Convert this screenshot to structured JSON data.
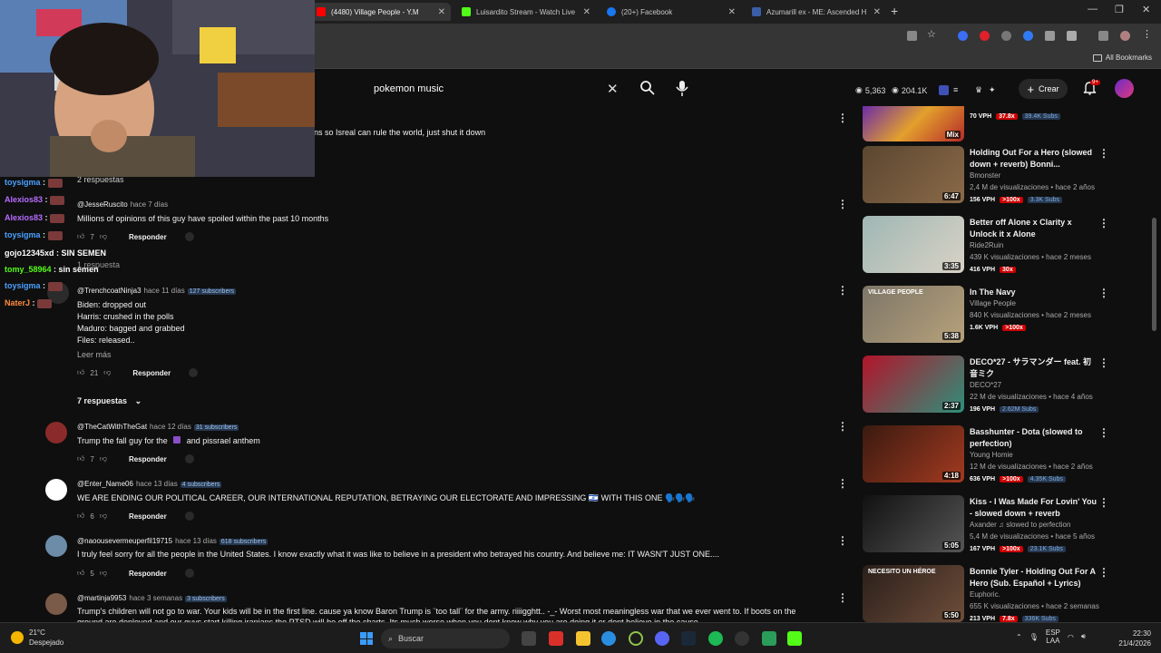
{
  "browser": {
    "tabs": [
      {
        "title": "(4480) Village People - Y.M",
        "color": "#ff0000",
        "active": true
      },
      {
        "title": "Luisardito Stream - Watch Live",
        "color": "#53fc18",
        "active": false
      },
      {
        "title": "(20+) Facebook",
        "color": "#1877f2",
        "active": false
      },
      {
        "title": "Azumarill ex - ME: Ascended H",
        "color": "#3b5ea8",
        "active": false
      }
    ],
    "all_bookmarks_label": "All Bookmarks"
  },
  "youtube": {
    "search_value": "pokemon music",
    "stats": {
      "views_a": "5,363",
      "views_b": "204.1K"
    },
    "create_label": "Crear",
    "notif_count": "9+"
  },
  "comments": {
    "top_fragment": "ns so Isreal can rule the world, just shut it down",
    "top_replies_label": "2 respuestas",
    "reply_label": "Responder",
    "show_more": "Leer más",
    "items": [
      {
        "author": "@JesseRuscito",
        "time": "hace 7 días",
        "subs": "",
        "text": "Millions of opinions of this guy have spoiled within the past 10 months",
        "likes": "7",
        "replies": "1 respuesta"
      },
      {
        "author": "@TrenchcoatNinja3",
        "time": "hace 11 días",
        "subs": "127 subscribers",
        "lines": [
          "Biden: dropped out",
          "Harris: crushed in the polls",
          "Maduro: bagged and grabbed",
          "Files: released.."
        ],
        "likes": "21",
        "replies": "7 respuestas"
      },
      {
        "author": "@TheCatWithTheGat",
        "time": "hace 12 días",
        "subs": "31 subscribers",
        "text_a": "Trump the fall guy for the",
        "text_b": "and pissrael anthem",
        "likes": "7"
      },
      {
        "author": "@Enter_Name06",
        "time": "hace 13 días",
        "subs": "4 subscribers",
        "text": "WE ARE ENDING OUR POLITICAL CAREER, OUR INTERNATIONAL REPUTATION, BETRAYING OUR ELECTORATE AND IMPRESSING 🇮🇱 WITH THIS ONE 🗣️🗣️🗣️",
        "likes": "6"
      },
      {
        "author": "@naoousevermeuperfil19715",
        "time": "hace 13 días",
        "subs": "618 subscribers",
        "text": "I truly feel sorry for all the people in the United States. I know exactly what it was like to believe in a president who betrayed his country. And believe me: IT WASN'T JUST ONE....",
        "likes": "5"
      },
      {
        "author": "@martinja9953",
        "time": "hace 3 semanas",
        "subs": "3 subscribers",
        "text": "Trump's children will not go to war. Your kids will be in the first line. cause ya know Baron Trump is ¨too tall¨ for the army. riiiigghtt.. -_- Worst most meaningless war that we ever went to. If boots on the",
        "text2": "ground are deployed and our guys start killing iranians the PTSD will be off the charts. Its much worse when you dont know why you are doing it or dont believe in the cause"
      }
    ]
  },
  "sidebar": {
    "first": {
      "vph": "70 VPH",
      "pct": "37.8x",
      "subs": "39.4K Subs",
      "mix": "Mix"
    },
    "videos": [
      {
        "title": "Holding Out For a Hero (slowed down + reverb) Bonni...",
        "channel": "Bmonster",
        "meta": "2,4 M de visualizaciones • hace 2 años",
        "vph": "156 VPH",
        "pct": ">100x",
        "subs": "3.3K Subs",
        "duration": "6:47",
        "thumb": [
          "#5b4630",
          "#8a6a48"
        ]
      },
      {
        "title": "Better off Alone x Clarity x Unlock it x Alone",
        "channel": "Ride2Ruin",
        "meta": "439 K visualizaciones • hace 2 meses",
        "vph": "416 VPH",
        "pct": "30x",
        "subs": "",
        "duration": "3:35",
        "thumb": [
          "#9fb7b4",
          "#d9d2c5"
        ]
      },
      {
        "title": "In The Navy",
        "channel": "Village People",
        "meta": "840 K visualizaciones • hace 2 meses",
        "vph": "1.6K VPH",
        "pct": ">100x",
        "subs": "",
        "duration": "5:38",
        "thumb": [
          "#7d7668",
          "#b7a17a"
        ],
        "overlay": "VILLAGE PEOPLE"
      },
      {
        "title": "DECO*27 - サラマンダー feat. 初音ミク",
        "channel": "DECO*27",
        "meta": "22 M de visualizaciones • hace 4 años",
        "vph": "196 VPH",
        "pct": "",
        "subs": "2.62M Subs",
        "duration": "2:37",
        "thumb": [
          "#b3142a",
          "#2f8f7b"
        ]
      },
      {
        "title": "Basshunter - Dota (slowed to perfection)",
        "channel": "Young Homie",
        "meta": "12 M de visualizaciones • hace 2 años",
        "vph": "636 VPH",
        "pct": ">100x",
        "subs": "4.35K Subs",
        "duration": "4:18",
        "thumb": [
          "#3a1a10",
          "#a33a20"
        ]
      },
      {
        "title": "Kiss - I Was Made For Lovin' You - slowed down + reverb",
        "channel": "Axander ♫ slowed to perfection",
        "meta": "5,4 M de visualizaciones • hace 5 años",
        "vph": "167 VPH",
        "pct": ">100x",
        "subs": "23.1K Subs",
        "duration": "5:05",
        "thumb": [
          "#111111",
          "#555555"
        ]
      },
      {
        "title": "Bonnie Tyler - Holding Out For A Hero (Sub. Español + Lyrics)",
        "channel": "Euphoric.",
        "meta": "655 K visualizaciones • hace 2 semanas",
        "vph": "213 VPH",
        "pct": "7.8x",
        "subs": "336K Subs",
        "duration": "5:50",
        "thumb": [
          "#2a1f1a",
          "#6e4d3a"
        ],
        "overlay": "NECESITO UN HÉROE"
      }
    ]
  },
  "chat": [
    {
      "user": "toysigma",
      "msg": "",
      "color": "#4aa0ff"
    },
    {
      "user": "Alexios83",
      "msg": "",
      "color": "#b66cff"
    },
    {
      "user": "Alexios83",
      "msg": "",
      "color": "#b66cff"
    },
    {
      "user": "toysigma",
      "msg": "",
      "color": "#4aa0ff"
    },
    {
      "user": "gojo12345xd",
      "msg": "SIN SEMEN",
      "color": "#ffffff"
    },
    {
      "user": "tomy_58964",
      "msg": "sin semen",
      "color": "#53fc18"
    },
    {
      "user": "toysigma",
      "msg": "",
      "color": "#4aa0ff"
    },
    {
      "user": "NaterJ",
      "msg": "",
      "color": "#ff8a3d"
    }
  ],
  "taskbar": {
    "temp": "21°C",
    "weather": "Despejado",
    "search_label": "Buscar",
    "lang": "ESP",
    "layout": "LAA",
    "time": "22:30",
    "date": "21/4/2026"
  }
}
